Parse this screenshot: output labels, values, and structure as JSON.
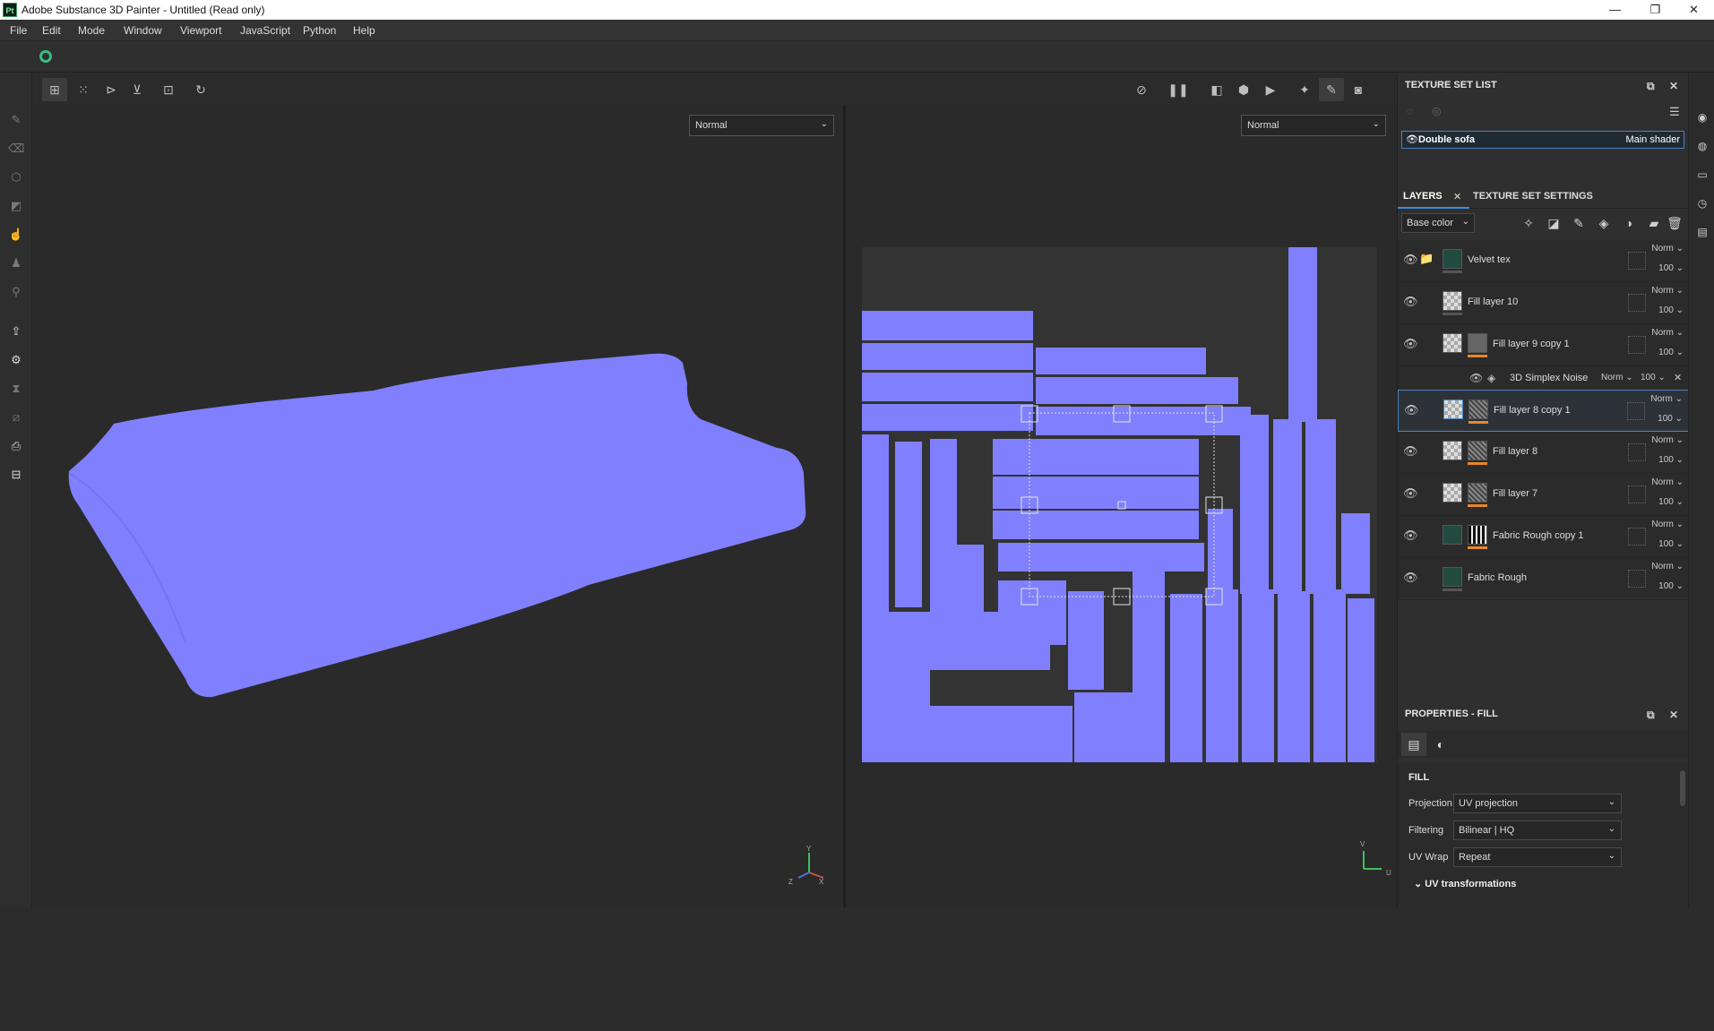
{
  "window": {
    "title": "Adobe Substance 3D Painter - Untitled (Read only)",
    "app_badge": "Pt",
    "minimize": "—",
    "maximize": "❐",
    "close": "✕"
  },
  "menu": [
    "File",
    "Edit",
    "Mode",
    "Window",
    "Viewport",
    "JavaScript",
    "Python",
    "Help"
  ],
  "viewport": {
    "left_blend": "Normal",
    "right_blend": "Normal",
    "mesh_color": "#8080ff",
    "axis_y": "Y",
    "axis_x": "X",
    "axis_z": "Z",
    "axis_v": "V",
    "axis_u": "U"
  },
  "texture_set_list": {
    "title": "TEXTURE SET LIST",
    "item_name": "Double sofa",
    "item_shader": "Main shader"
  },
  "layers_panel": {
    "tab_layers": "LAYERS",
    "tab_settings": "TEXTURE SET SETTINGS",
    "channel": "Base color",
    "layers": [
      {
        "name": "Velvet tex",
        "blend": "Norm",
        "opacity": "100"
      },
      {
        "name": "Fill layer 10",
        "blend": "Norm",
        "opacity": "100"
      },
      {
        "name": "Fill layer 9 copy 1",
        "blend": "Norm",
        "opacity": "100"
      },
      {
        "name": "Fill layer 8 copy 1",
        "blend": "Norm",
        "opacity": "100"
      },
      {
        "name": "Fill layer 8",
        "blend": "Norm",
        "opacity": "100"
      },
      {
        "name": "Fill layer 7",
        "blend": "Norm",
        "opacity": "100"
      },
      {
        "name": "Fabric Rough copy 1",
        "blend": "Norm",
        "opacity": "100"
      },
      {
        "name": "Fabric Rough",
        "blend": "Norm",
        "opacity": "100"
      }
    ],
    "effect": {
      "name": "3D Simplex Noise",
      "blend": "Norm",
      "opacity": "100"
    }
  },
  "properties": {
    "title": "PROPERTIES - FILL",
    "section": "FILL",
    "rows": [
      {
        "label": "Projection",
        "value": "UV projection"
      },
      {
        "label": "Filtering",
        "value": "Bilinear | HQ"
      },
      {
        "label": "UV Wrap",
        "value": "Repeat"
      }
    ],
    "subsection": "UV transformations"
  }
}
